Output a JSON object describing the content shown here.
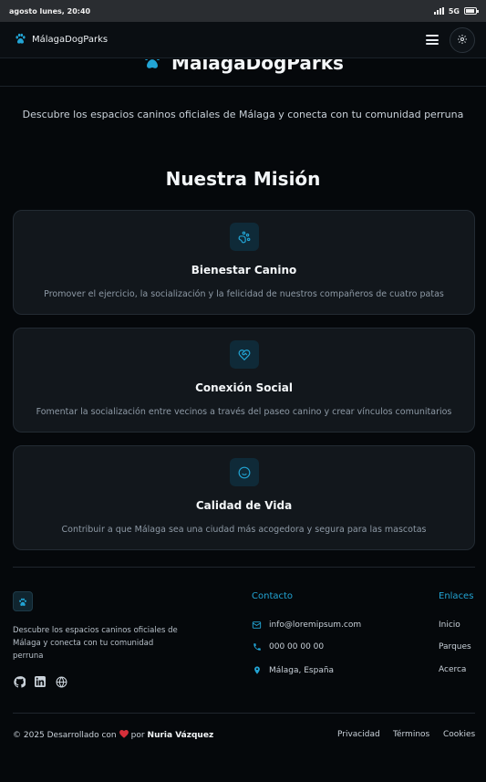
{
  "status_bar": {
    "time": "agosto lunes, 20:40",
    "network": "5G",
    "battery_level": 0.9
  },
  "navbar": {
    "brand": "MálagaDogParks",
    "menu_icon": "hamburger-icon",
    "settings_icon": "gear-icon"
  },
  "hero": {
    "title": "MálagaDogParks",
    "subtitle": "Descubre los espacios caninos oficiales de Málaga y conecta con tu comunidad perruna"
  },
  "mission": {
    "title": "Nuestra Misión",
    "cards": [
      {
        "icon": "paw-hand-icon",
        "title": "Bienestar Canino",
        "description": "Promover el ejercicio, la socialización y la felicidad de nuestros compañeros de cuatro patas"
      },
      {
        "icon": "heart-handshake-icon",
        "title": "Conexión Social",
        "description": "Fomentar la socialización entre vecinos a través del paseo canino y crear vínculos comunitarios"
      },
      {
        "icon": "smile-icon",
        "title": "Calidad de Vida",
        "description": "Contribuir a que Málaga sea una ciudad más acogedora y segura para las mascotas"
      }
    ]
  },
  "footer": {
    "description": "Descubre los espacios caninos oficiales de Málaga y conecta con tu comunidad perruna",
    "social_icons": [
      "github-icon",
      "linkedin-icon",
      "globe-icon"
    ],
    "contact": {
      "title": "Contacto",
      "email": "info@loremipsum.com",
      "phone": "000 00 00 00",
      "location": "Málaga, España"
    },
    "links": {
      "title": "Enlaces",
      "items": [
        "Inicio",
        "Parques",
        "Acerca"
      ]
    },
    "copyright_prefix": "© 2025 Desarrollado con",
    "copyright_by": "por",
    "author": "Nuria Vázquez",
    "legal": [
      "Privacidad",
      "Términos",
      "Cookies"
    ]
  },
  "colors": {
    "accent": "#22a4d4",
    "background": "#05080b",
    "card": "#12171c",
    "heart": "#d62f3a"
  }
}
